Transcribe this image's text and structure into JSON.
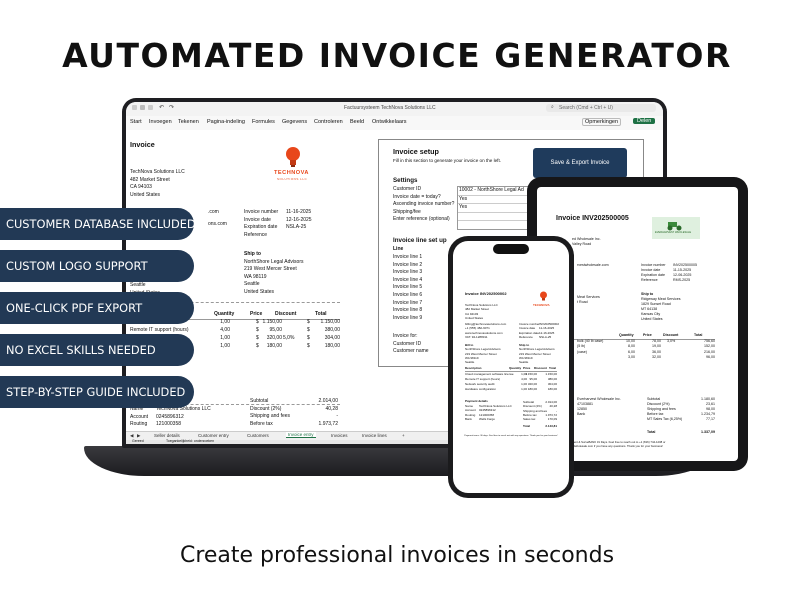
{
  "headline": "AUTOMATED INVOICE GENERATOR",
  "tagline": "Create professional invoices in seconds",
  "features": [
    "CUSTOMER DATABASE INCLUDED",
    "CUSTOM LOGO SUPPORT",
    "ONE-CLICK PDF EXPORT",
    "NO EXCEL SKILLS NEEDED",
    "STEP-BY-STEP GUIDE INCLUDED"
  ],
  "colors": {
    "accent_navy": "#223955",
    "excel_green": "#1e7145",
    "logo_orange": "#e8471b"
  },
  "excel": {
    "file_title": "Factuursysteem TechNova Solutions LLC",
    "search_placeholder": "Search (Cmd + Ctrl + U)",
    "menu": [
      "Start",
      "Invoegen",
      "Tekenen",
      "Pagina-indeling",
      "Formules",
      "Gegevens",
      "Controleren",
      "Beeld",
      "Ontwikkelaars"
    ],
    "opmerkingen": "Opmerkingen",
    "delen": "Delen",
    "sheet_tabs": [
      "Seller details",
      "Customer entry",
      "Customers",
      "Invoice entry",
      "Invoices",
      "Invoice lines"
    ],
    "status_left": "Gereed",
    "status_acc": "Toegankelijkheid: onderzoeken",
    "invoice": {
      "title": "Invoice",
      "logo_text": "TECHNOVA",
      "logo_sub": "SOLUTIONS LLC",
      "seller": [
        "TechNova Solutions LLC",
        "482 Market Street",
        "CA 94103",
        "United States"
      ],
      "seller_contact": [
        ".com",
        "ons.com"
      ],
      "meta_labels": [
        "Invoice number",
        "Invoice date",
        "Expiration date",
        "Reference"
      ],
      "meta_values": [
        "",
        "11-16-2025",
        "12-16-2025",
        "NSLA-25"
      ],
      "ship_to_label": "Ship to",
      "ship_to": [
        "NorthShore Legal Advisors",
        "219 West Mercer Street",
        "WA 98119",
        "Seattle",
        "United States"
      ],
      "bill_fragments": [
        "Seattle",
        "United States"
      ],
      "line_headers": [
        "Quantity",
        "Price",
        "Discount",
        "Total"
      ],
      "lines": [
        {
          "desc": "icense",
          "qty": "1,00",
          "cur": "$",
          "price": "1.150,00",
          "disc": "",
          "cur2": "$",
          "total": "1.150,00"
        },
        {
          "desc": "Remote IT support (hours)",
          "qty": "4,00",
          "cur": "$",
          "price": "95,00",
          "disc": "",
          "cur2": "$",
          "total": "380,00"
        },
        {
          "desc": "",
          "qty": "1,00",
          "cur": "$",
          "price": "320,00",
          "disc": "5,0%",
          "cur2": "$",
          "total": "304,00"
        },
        {
          "desc": "",
          "qty": "1,00",
          "cur": "$",
          "price": "180,00",
          "disc": "",
          "cur2": "$",
          "total": "180,00"
        }
      ],
      "bank_labels": [
        "Name",
        "Account",
        "Routing"
      ],
      "bank_values": [
        "TechNova Solutions LLC",
        "0245896312",
        "121000358"
      ],
      "sum_labels": [
        "Subtotal",
        "Discount (2%)",
        "Shipping and fees",
        "Before tax"
      ],
      "sum_values": [
        "2.014,00",
        "40,28",
        "-",
        "1.973,72"
      ]
    },
    "setup": {
      "title": "Invoice setup",
      "intro": "Fill in this section to generate your invoice on the left.",
      "button": "Save & Export Invoice",
      "settings_title": "Settings",
      "settings_labels": [
        "Customer ID",
        "Invoice date = today?",
        "Ascending invoice number?",
        "Shipping/fee",
        "Enter reference (optional)"
      ],
      "settings_values": [
        "10002 - NorthShore Legal Ad",
        "Yes",
        "Yes",
        "",
        ""
      ],
      "lines_title": "Invoice line set up",
      "line_col": "Line",
      "line_items": [
        "Invoice line 1",
        "Invoice line 2",
        "Invoice line 3",
        "Invoice line 4",
        "Invoice line 5",
        "Invoice line 6",
        "Invoice line 7",
        "Invoice line 8",
        "Invoice line 9"
      ],
      "footer_labels": [
        "Invoice for:",
        "Customer ID",
        "Customer name"
      ]
    }
  },
  "tablet": {
    "title": "Invoice INV202500005",
    "logo_text": "EVERHARVEST WHOLESALE",
    "company": "ed Wholesale Inc.",
    "company_2": "Valley Road",
    "email": "rvestwholesale.com",
    "meta_labels": [
      "Invoice number",
      "Invoice date",
      "Expiration date",
      "Reference"
    ],
    "meta_values": [
      "INV202500005",
      "11-15-2025",
      "12-06-2025",
      "RMS-2025"
    ],
    "ship_to_label": "Ship to",
    "ship_to": [
      "Ridgeway Meat Services",
      "1829 Sunset Road",
      "MT 64138",
      "Kansas City",
      "United States"
    ],
    "bill_fragment": [
      "Meat Services",
      "t Road"
    ],
    "line_headers": [
      "Quantity",
      "Price",
      "Discount",
      "Total"
    ],
    "lines": [
      {
        "desc": "bulk (40 lb case)",
        "qty": "10,00",
        "price": "78,00",
        "disc": "3,0%",
        "total": "756,60"
      },
      {
        "desc": "(5 lb)",
        "qty": "8,00",
        "price": "19,00",
        "disc": "",
        "total": "152,00"
      },
      {
        "desc": "(case)",
        "qty": "6,00",
        "price": "36,00",
        "disc": "",
        "total": "216,00"
      },
      {
        "desc": "",
        "qty": "3,00",
        "price": "32,00",
        "disc": "",
        "total": "96,00"
      }
    ],
    "bank": [
      "Everharvest Wholesale Inc.",
      "47103881",
      "12850"
    ],
    "bank_name_label": "Bank",
    "sum_labels": [
      "Subtotal",
      "Discount (2%)",
      "Shipping and fees",
      "Before tax",
      "MT Sales Tax (6,25%)"
    ],
    "sum_values": [
      "1.180,60",
      "23,61",
      "98,00",
      "1.234,79",
      "77,17"
    ],
    "total_label": "Total",
    "total_value": "1.337,09",
    "footer": [
      "payment & SurveBANK 31 Days. Feel free to reach out to +1 (816) 744-1208 or",
      "arvestwholesale.com if you have any questions. Thank you for your business!"
    ]
  },
  "phone": {
    "title": "Invoice INV202500002",
    "logo_text": "TECHNOVA",
    "seller": [
      "TechNova Solutions LLC",
      "482 Market Street",
      "CA 94103",
      "United States"
    ],
    "contact": [
      "billing@technovasolutions.com",
      "+1 (555) 482-9071",
      "www.technovasolutions.com",
      "VAT: 94-1288311"
    ],
    "meta_labels": [
      "Invoice number",
      "Invoice date",
      "Expiration date",
      "Reference"
    ],
    "meta_values": [
      "INV202500002",
      "11-16-2025",
      "12-16-2025",
      "NSLA-25"
    ],
    "bill_label": "Bill to",
    "bill": [
      "NorthShore Legal Advisors",
      "219 West Mercer Street",
      "WA 98119",
      "Seattle"
    ],
    "ship_label": "Ship to",
    "ship": [
      "NorthShore Legal Advisors",
      "219 West Mercer Street",
      "WA 98119",
      "Seattle"
    ],
    "line_headers": [
      "Description",
      "Quantity",
      "Price",
      "Discount",
      "Total"
    ],
    "lines": [
      {
        "desc": "Cloud management software license",
        "qty": "1,00",
        "price": "1.150,00",
        "total": "1.150,00"
      },
      {
        "desc": "Remote IT support (hours)",
        "qty": "4,00",
        "price": "95,00",
        "total": "380,00"
      },
      {
        "desc": "Network security audit",
        "qty": "1,00",
        "price": "320,00",
        "total": "304,00"
      },
      {
        "desc": "Hardware configuration",
        "qty": "1,00",
        "price": "180,00",
        "total": "180,00"
      }
    ],
    "bank_title": "Payment details",
    "bank_labels": [
      "Name",
      "Account",
      "Routing",
      "Bank"
    ],
    "bank_values": [
      "TechNova Solutions LLC",
      "0245896312",
      "121000358",
      "Wells Fargo"
    ],
    "sum_labels": [
      "Subtotal",
      "Discount (2%)",
      "Shipping and fees",
      "Before tax",
      "Sales tax"
    ],
    "sum_values": [
      "2.014,00",
      "40,28",
      "-",
      "1.973,72",
      "170,09"
    ],
    "total_label": "Total",
    "total_value": "2.143,81",
    "footer": "Payment terms: 30 days. Feel free to reach out with any questions. Thank you for your business!"
  }
}
